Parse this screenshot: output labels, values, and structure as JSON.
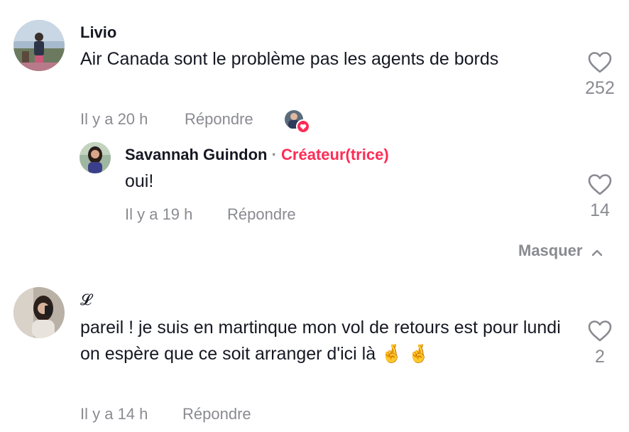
{
  "comments": [
    {
      "author": "Livio",
      "text": "Air Canada sont le problème pas les agents de bords",
      "time": "Il y a 20 h",
      "reply_label": "Répondre",
      "likes": "252"
    },
    {
      "author": "Savannah Guindon",
      "separator": "·",
      "badge": "Créateur(trice)",
      "text": "oui!",
      "time": "Il y a 19 h",
      "reply_label": "Répondre",
      "likes": "14"
    },
    {
      "author": "𝓛",
      "text": "pareil ! je suis en martinque mon vol de retours est pour lundi on espère que ce soit arranger d'ici là 🤞 🤞",
      "time": "Il y a 14 h",
      "reply_label": "Répondre",
      "likes": "2"
    }
  ],
  "hide_replies_label": "Masquer",
  "colors": {
    "accent": "#fe2c55",
    "muted": "#8a8b91",
    "text": "#161823"
  },
  "icons": [
    "heart-icon",
    "liked-by-creator-icon",
    "chevron-up-icon"
  ]
}
